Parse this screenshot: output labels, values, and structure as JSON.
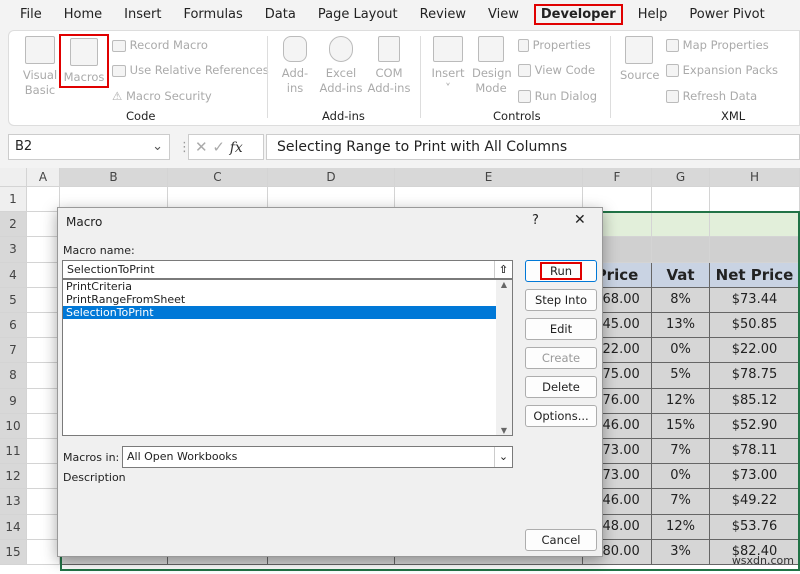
{
  "menu": [
    "File",
    "Home",
    "Insert",
    "Formulas",
    "Data",
    "Page Layout",
    "Review",
    "View",
    "Developer",
    "Help",
    "Power Pivot"
  ],
  "ribbon": {
    "code": {
      "visual_basic": "Visual Basic",
      "macros": "Macros",
      "record_macro": "Record Macro",
      "relative": "Use Relative References",
      "security": "Macro Security",
      "label": "Code"
    },
    "addins": {
      "addins": "Add-ins",
      "excel_addins": "Excel Add-ins",
      "com_addins": "COM Add-ins",
      "label": "Add-ins"
    },
    "controls": {
      "insert": "Insert",
      "design_mode": "Design Mode",
      "properties": "Properties",
      "view_code": "View Code",
      "run_dialog": "Run Dialog",
      "label": "Controls"
    },
    "xml": {
      "source": "Source",
      "map_properties": "Map Properties",
      "expansion_packs": "Expansion Packs",
      "refresh_data": "Refresh Data",
      "label": "XML"
    }
  },
  "formula_bar": {
    "name_box": "B2",
    "fx": "fx",
    "content": "Selecting Range to Print with All Columns"
  },
  "columns": [
    "A",
    "B",
    "C",
    "D",
    "E",
    "F",
    "G",
    "H"
  ],
  "rows": [
    "1",
    "2",
    "3",
    "4",
    "5",
    "6",
    "7",
    "8",
    "9",
    "10",
    "11",
    "12",
    "13",
    "14",
    "15"
  ],
  "table": {
    "headers": [
      "Price",
      "Vat",
      "Net Price"
    ],
    "rows": [
      [
        "$68.00",
        "8%",
        "$73.44"
      ],
      [
        "$45.00",
        "13%",
        "$50.85"
      ],
      [
        "$22.00",
        "0%",
        "$22.00"
      ],
      [
        "$75.00",
        "5%",
        "$78.75"
      ],
      [
        "$76.00",
        "12%",
        "$85.12"
      ],
      [
        "$46.00",
        "15%",
        "$52.90"
      ],
      [
        "$73.00",
        "7%",
        "$78.11"
      ],
      [
        "$73.00",
        "0%",
        "$73.00"
      ],
      [
        "$46.00",
        "7%",
        "$49.22"
      ],
      [
        "$48.00",
        "12%",
        "$53.76"
      ],
      [
        "$80.00",
        "3%",
        "$82.40"
      ]
    ]
  },
  "dialog": {
    "title": "Macro",
    "help": "?",
    "close": "✕",
    "macro_name_label": "Macro name:",
    "macro_name_value": "SelectionToPrint",
    "macros": [
      "PrintCriteria",
      "PrintRangeFromSheet",
      "SelectionToPrint"
    ],
    "selected_index": 2,
    "buttons": {
      "run": "Run",
      "step_into": "Step Into",
      "edit": "Edit",
      "create": "Create",
      "delete": "Delete",
      "options": "Options...",
      "cancel": "Cancel"
    },
    "macros_in_label": "Macros in:",
    "macros_in_value": "All Open Workbooks",
    "description_label": "Description"
  },
  "watermark": "wsxdn.com",
  "colors": {
    "highlight": "#e00000",
    "selection": "#0078d7",
    "header_fill": "#c9d3e3",
    "grid_green": "#217346"
  }
}
